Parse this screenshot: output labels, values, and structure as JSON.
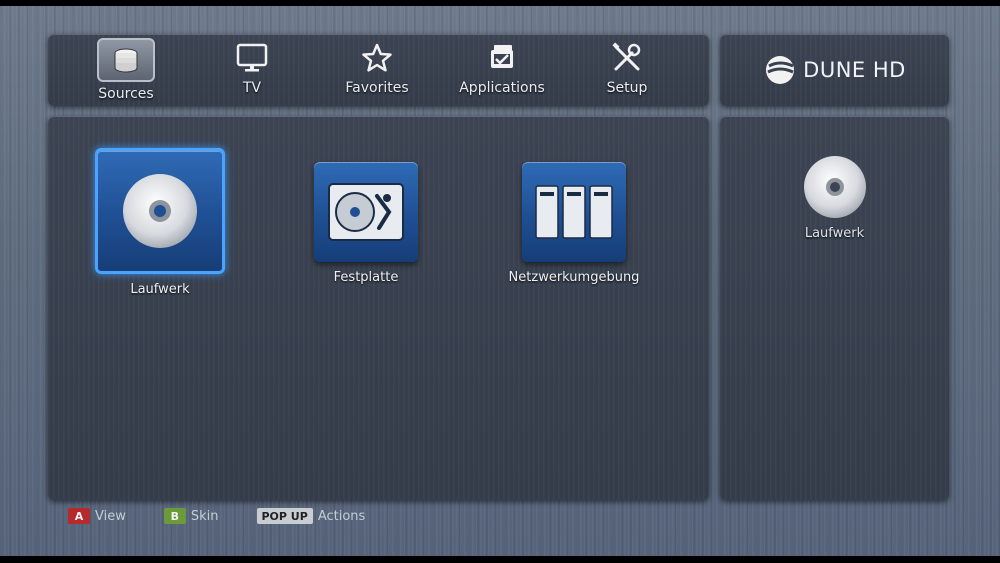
{
  "menu": {
    "items": [
      {
        "label": "Sources",
        "icon": "database-icon",
        "active": true
      },
      {
        "label": "TV",
        "icon": "tv-icon",
        "active": false
      },
      {
        "label": "Favorites",
        "icon": "star-icon",
        "active": false
      },
      {
        "label": "Applications",
        "icon": "applications-icon",
        "active": false
      },
      {
        "label": "Setup",
        "icon": "tools-icon",
        "active": false
      }
    ]
  },
  "logo": {
    "text": "DUNE HD"
  },
  "sources": [
    {
      "label": "Laufwerk",
      "icon": "disc-icon",
      "selected": true
    },
    {
      "label": "Festplatte",
      "icon": "hard-drive-icon",
      "selected": false
    },
    {
      "label": "Netzwerkumgebung",
      "icon": "network-icon",
      "selected": false
    }
  ],
  "preview": {
    "label": "Laufwerk",
    "icon": "disc-icon"
  },
  "hints": [
    {
      "key": "A",
      "label": "View",
      "color": "#b52a2a"
    },
    {
      "key": "B",
      "label": "Skin",
      "color": "#6b9a3a"
    },
    {
      "key": "POP UP",
      "label": "Actions",
      "color": "#c9ccd1"
    }
  ],
  "colors": {
    "accent": "#4aa3ff",
    "tile": "#1f4f93"
  }
}
